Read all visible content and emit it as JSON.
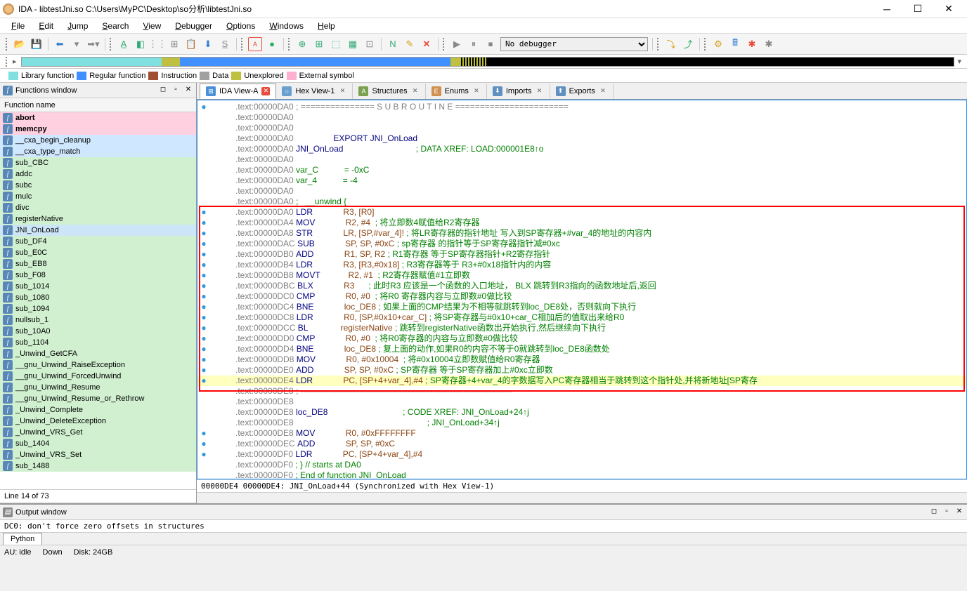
{
  "title": "IDA - libtestJni.so C:\\Users\\MyPC\\Desktop\\so分析\\libtestJni.so",
  "menu": [
    "File",
    "Edit",
    "Jump",
    "Search",
    "View",
    "Debugger",
    "Options",
    "Windows",
    "Help"
  ],
  "debugger_combo": "No debugger",
  "legend": [
    {
      "c": "#80e0e0",
      "t": "Library function"
    },
    {
      "c": "#4090ff",
      "t": "Regular function"
    },
    {
      "c": "#a05030",
      "t": "Instruction"
    },
    {
      "c": "#a0a0a0",
      "t": "Data"
    },
    {
      "c": "#c0c040",
      "t": "Unexplored"
    },
    {
      "c": "#ffb0d0",
      "t": "External symbol"
    }
  ],
  "funcs_title": "Functions window",
  "funcs_header": "Function name",
  "functions": [
    {
      "name": "abort",
      "bg": "bg-pink",
      "bold": true
    },
    {
      "name": "memcpy",
      "bg": "bg-pink",
      "bold": true
    },
    {
      "name": "__cxa_begin_cleanup",
      "bg": "bg-bluebg"
    },
    {
      "name": "__cxa_type_match",
      "bg": "bg-bluebg"
    },
    {
      "name": "sub_CBC",
      "bg": "bg-green"
    },
    {
      "name": "addc",
      "bg": "bg-green"
    },
    {
      "name": "subc",
      "bg": "bg-green"
    },
    {
      "name": "mulc",
      "bg": "bg-green"
    },
    {
      "name": "divc",
      "bg": "bg-green"
    },
    {
      "name": "registerNative",
      "bg": "bg-green"
    },
    {
      "name": "JNI_OnLoad",
      "bg": "",
      "sel": true
    },
    {
      "name": "sub_DF4",
      "bg": "bg-green"
    },
    {
      "name": "sub_E0C",
      "bg": "bg-green"
    },
    {
      "name": "sub_EB8",
      "bg": "bg-green"
    },
    {
      "name": "sub_F08",
      "bg": "bg-green"
    },
    {
      "name": "sub_1014",
      "bg": "bg-green"
    },
    {
      "name": "sub_1080",
      "bg": "bg-green"
    },
    {
      "name": "sub_1094",
      "bg": "bg-green"
    },
    {
      "name": "nullsub_1",
      "bg": "bg-green"
    },
    {
      "name": "sub_10A0",
      "bg": "bg-green"
    },
    {
      "name": "sub_1104",
      "bg": "bg-green"
    },
    {
      "name": "_Unwind_GetCFA",
      "bg": "bg-green"
    },
    {
      "name": "__gnu_Unwind_RaiseException",
      "bg": "bg-green"
    },
    {
      "name": "__gnu_Unwind_ForcedUnwind",
      "bg": "bg-green"
    },
    {
      "name": "__gnu_Unwind_Resume",
      "bg": "bg-green"
    },
    {
      "name": "__gnu_Unwind_Resume_or_Rethrow",
      "bg": "bg-green"
    },
    {
      "name": "_Unwind_Complete",
      "bg": "bg-green"
    },
    {
      "name": "_Unwind_DeleteException",
      "bg": "bg-green"
    },
    {
      "name": "_Unwind_VRS_Get",
      "bg": "bg-green"
    },
    {
      "name": "sub_1404",
      "bg": "bg-green"
    },
    {
      "name": "_Unwind_VRS_Set",
      "bg": "bg-green"
    },
    {
      "name": "sub_1488",
      "bg": "bg-green"
    }
  ],
  "funcs_status": "Line 14 of 73",
  "tabs": [
    {
      "icon": "#4a90d9",
      "iconText": "⊞",
      "label": "IDA View-A",
      "active": true,
      "closeRed": true
    },
    {
      "icon": "#6aa0d0",
      "iconText": "○",
      "label": "Hex View-1",
      "closeRed": false
    },
    {
      "icon": "#7aa050",
      "iconText": "A",
      "label": "Structures",
      "closeRed": false
    },
    {
      "icon": "#d09050",
      "iconText": "E",
      "label": "Enums",
      "closeRed": false
    },
    {
      "icon": "#6090c0",
      "iconText": "⬇",
      "label": "Imports",
      "closeRed": false
    },
    {
      "icon": "#6090c0",
      "iconText": "⬆",
      "label": "Exports",
      "closeRed": false
    }
  ],
  "disasm": [
    {
      "d": "●",
      "a": ".text:00000DA0",
      "t": "; =============== S U B R O U T I N E ======================="
    },
    {
      "d": "",
      "a": ".text:00000DA0",
      "t": ""
    },
    {
      "d": "",
      "a": ".text:00000DA0",
      "t": ""
    },
    {
      "d": "",
      "a": ".text:00000DA0",
      "mid": "                EXPORT JNI_OnLoad",
      "midcls": "kw"
    },
    {
      "d": "",
      "a": ".text:00000DA0",
      "lbl": "JNI_OnLoad",
      "cmt": "                               ; DATA XREF: LOAD:000001E8↑o"
    },
    {
      "d": "",
      "a": ".text:00000DA0",
      "t": ""
    },
    {
      "d": "",
      "a": ".text:00000DA0",
      "var": "var_C           = -0xC"
    },
    {
      "d": "",
      "a": ".text:00000DA0",
      "var": "var_4           = -4"
    },
    {
      "d": "",
      "a": ".text:00000DA0",
      "t": ""
    },
    {
      "d": "",
      "a": ".text:00000DA0",
      "cmt": ";   __unwind {"
    },
    {
      "d": "●",
      "a": ".text:00000DA0",
      "op": "LDR",
      "args": "R3, [R0]",
      "box": true
    },
    {
      "d": "●",
      "a": ".text:00000DA4",
      "op": "MOV",
      "args": "R2, #4",
      "cmt": "  ; 将立即数4赋值给R2寄存器",
      "box": true
    },
    {
      "d": "●",
      "a": ".text:00000DA8",
      "op": "STR",
      "args": "LR, [SP,#var_4]!",
      "cmt": " ; 将LR寄存器的指针地址 写入到SP寄存器+#var_4的地址的内容内",
      "box": true
    },
    {
      "d": "●",
      "a": ".text:00000DAC",
      "op": "SUB",
      "args": "SP, SP, #0xC",
      "cmt": " ; sp寄存器 的指针等于SP寄存器指针减#0xc",
      "box": true
    },
    {
      "d": "●",
      "a": ".text:00000DB0",
      "op": "ADD",
      "args": "R1, SP, R2",
      "cmt": " ; R1寄存器 等于SP寄存器指针+R2寄存指针",
      "box": true
    },
    {
      "d": "●",
      "a": ".text:00000DB4",
      "op": "LDR",
      "args": "R3, [R3,#0x18]",
      "cmt": " ; R3寄存器等于 R3+#0x18指针内的内容",
      "box": true
    },
    {
      "d": "●",
      "a": ".text:00000DB8",
      "op": "MOVT",
      "args": "R2, #1",
      "cmt": "  ; R2寄存器赋值#1立即数",
      "box": true
    },
    {
      "d": "●",
      "a": ".text:00000DBC",
      "op": "BLX",
      "args": "R3",
      "cmt": "      ; 此时R3 应该是一个函数的入口地址， BLX 跳转到R3指向的函数地址后,返回",
      "box": true
    },
    {
      "d": "●",
      "a": ".text:00000DC0",
      "op": "CMP",
      "args": "R0, #0",
      "cmt": "  ; 将R0 寄存器内容与立即数#0做比较",
      "box": true
    },
    {
      "d": "●",
      "a": ".text:00000DC4",
      "op": "BNE",
      "args": "loc_DE8",
      "cmt": " ; 如果上面的CMP结果为不相等就跳转到loc_DE8处，否则就向下执行",
      "box": true
    },
    {
      "d": "●",
      "a": ".text:00000DC8",
      "op": "LDR",
      "args": "R0, [SP,#0x10+car_C]",
      "cmt": " ; 将SP寄存器与#0x10+car_C相加后的值取出来给R0",
      "box": true
    },
    {
      "d": "●",
      "a": ".text:00000DCC",
      "op": "BL",
      "args": "registerNative",
      "cmt": " ; 跳转到registerNative函数出开始执行,然后继续向下执行",
      "box": true
    },
    {
      "d": "●",
      "a": ".text:00000DD0",
      "op": "CMP",
      "args": "R0, #0",
      "cmt": "  ; 将R0寄存器的内容与立即数#0做比较",
      "box": true
    },
    {
      "d": "●",
      "a": ".text:00000DD4",
      "op": "BNE",
      "args": "loc_DE8",
      "cmt": " ; 复上面的动作,如果R0的内容不等于0就跳转到loc_DE8函数处",
      "box": true
    },
    {
      "d": "●",
      "a": ".text:00000DD8",
      "op": "MOV",
      "args": "R0, #0x10004",
      "cmt": "  ; 将#0x10004立即数赋值给R0寄存器",
      "box": true
    },
    {
      "d": "●",
      "a": ".text:00000DE0",
      "op": "ADD",
      "args": "SP, SP, #0xC",
      "cmt": " ; SP寄存器 等于SP寄存器加上#0xc立即数",
      "box": true
    },
    {
      "d": "●",
      "a": ".text:00000DE4",
      "op": "LDR",
      "args": "PC, [SP+4+var_4],#4",
      "cmt": " ; SP寄存器+4+var_4的字数据写入PC寄存器相当于跳转到这个指针处,并将新地址[SP寄存",
      "box": true,
      "hl": true
    },
    {
      "d": "",
      "a": ".text:00000DE8",
      "sep": true
    },
    {
      "d": "",
      "a": ".text:00000DE8",
      "t": ""
    },
    {
      "d": "",
      "a": ".text:00000DE8",
      "lbl": "loc_DE8",
      "cmt": "                                ; CODE XREF: JNI_OnLoad+24↑j"
    },
    {
      "d": "",
      "a": ".text:00000DE8",
      "cmt": "                                                        ; JNI_OnLoad+34↑j"
    },
    {
      "d": "●",
      "a": ".text:00000DE8",
      "op": "MOV",
      "args": "R0, #0xFFFFFFFF"
    },
    {
      "d": "●",
      "a": ".text:00000DEC",
      "op": "ADD",
      "args": "SP, SP, #0xC"
    },
    {
      "d": "●",
      "a": ".text:00000DF0",
      "op": "LDR",
      "args": "PC, [SP+4+var_4],#4"
    },
    {
      "d": "",
      "a": ".text:00000DF0",
      "cmt": "; } // starts at DA0"
    },
    {
      "d": "",
      "a": ".text:00000DF0",
      "cmt": "; End of function JNI_OnLoad"
    }
  ],
  "sync_text": "00000DE4 00000DE4: JNI_OnLoad+44 (Synchronized with Hex View-1)",
  "output_title": "Output window",
  "output_text": "DC0: don't force zero offsets in structures",
  "python_tab": "Python",
  "bottom": {
    "au": "AU: idle",
    "down": "Down",
    "disk": "Disk: 24GB"
  }
}
